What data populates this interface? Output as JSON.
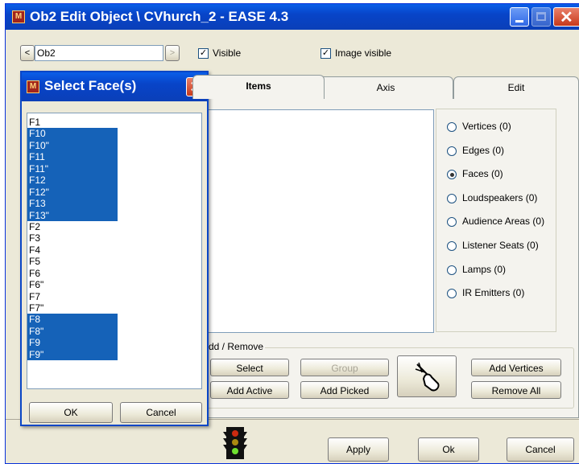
{
  "window": {
    "title": "Ob2 Edit Object \\ CVhurch_2 - EASE 4.3",
    "icon_text": "M"
  },
  "toolbar": {
    "object_value": "Ob2",
    "prev_arrow": "<",
    "next_arrow": ">",
    "visible_label": "Visible",
    "image_visible_label": "Image visible",
    "check_mark": "✓"
  },
  "tabs": [
    "Items",
    "Axis",
    "Edit"
  ],
  "radios": [
    {
      "label": "Vertices (0)",
      "selected": false
    },
    {
      "label": "Edges (0)",
      "selected": false
    },
    {
      "label": "Faces (0)",
      "selected": true
    },
    {
      "label": "Loudspeakers (0)",
      "selected": false
    },
    {
      "label": "Audience Areas (0)",
      "selected": false
    },
    {
      "label": "Listener Seats (0)",
      "selected": false
    },
    {
      "label": "Lamps (0)",
      "selected": false
    },
    {
      "label": "IR Emitters (0)",
      "selected": false
    }
  ],
  "add_remove": {
    "group_label": "Add / Remove",
    "select": "Select",
    "group": "Group",
    "add_active": "Add Active",
    "add_picked": "Add Picked",
    "add_vertices": "Add Vertices",
    "remove_all": "Remove All"
  },
  "footer": {
    "apply": "Apply",
    "ok": "Ok",
    "cancel": "Cancel"
  },
  "dialog": {
    "title": "Select Face(s)",
    "close": "✕",
    "ok": "OK",
    "cancel": "Cancel",
    "faces": [
      {
        "label": "F1",
        "selected": false
      },
      {
        "label": "F10",
        "selected": true
      },
      {
        "label": "F10\"",
        "selected": true
      },
      {
        "label": "F11",
        "selected": true
      },
      {
        "label": "F11\"",
        "selected": true
      },
      {
        "label": "F12",
        "selected": true
      },
      {
        "label": "F12\"",
        "selected": true
      },
      {
        "label": "F13",
        "selected": true
      },
      {
        "label": "F13\"",
        "selected": true
      },
      {
        "label": "F2",
        "selected": false
      },
      {
        "label": "F3",
        "selected": false
      },
      {
        "label": "F4",
        "selected": false
      },
      {
        "label": "F5",
        "selected": false
      },
      {
        "label": "F6",
        "selected": false
      },
      {
        "label": "F6\"",
        "selected": false
      },
      {
        "label": "F7",
        "selected": false
      },
      {
        "label": "F7\"",
        "selected": false
      },
      {
        "label": "F8",
        "selected": true
      },
      {
        "label": "F8\"",
        "selected": true
      },
      {
        "label": "F9",
        "selected": true
      },
      {
        "label": "F9\"",
        "selected": true
      }
    ]
  }
}
